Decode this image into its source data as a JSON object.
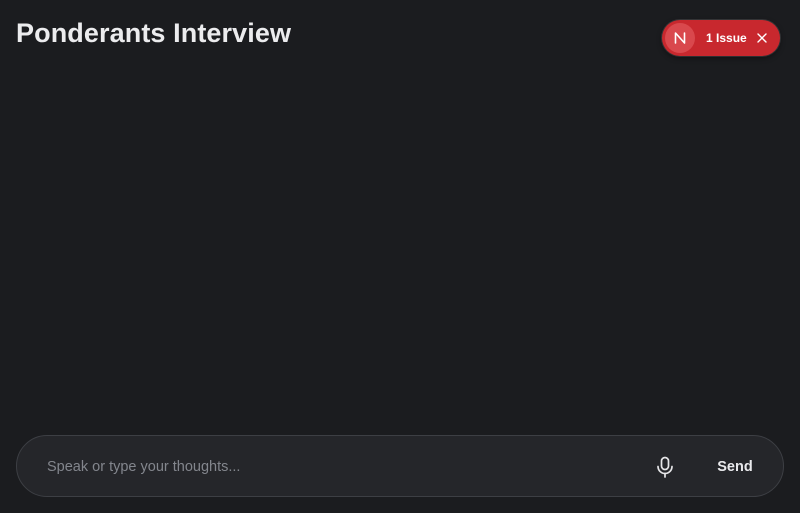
{
  "header": {
    "title": "Ponderants Interview"
  },
  "issue_badge": {
    "logo_letter": "N",
    "label": "1 Issue",
    "logo_icon": "n-logo-icon",
    "close_icon": "close-icon",
    "color": "#c8282e"
  },
  "composer": {
    "placeholder": "Speak or type your thoughts...",
    "value": "",
    "mic_icon": "microphone-icon",
    "send_label": "Send"
  },
  "colors": {
    "background": "#1b1c1f",
    "composer_background": "#25262a",
    "composer_border": "#3d3f44"
  }
}
